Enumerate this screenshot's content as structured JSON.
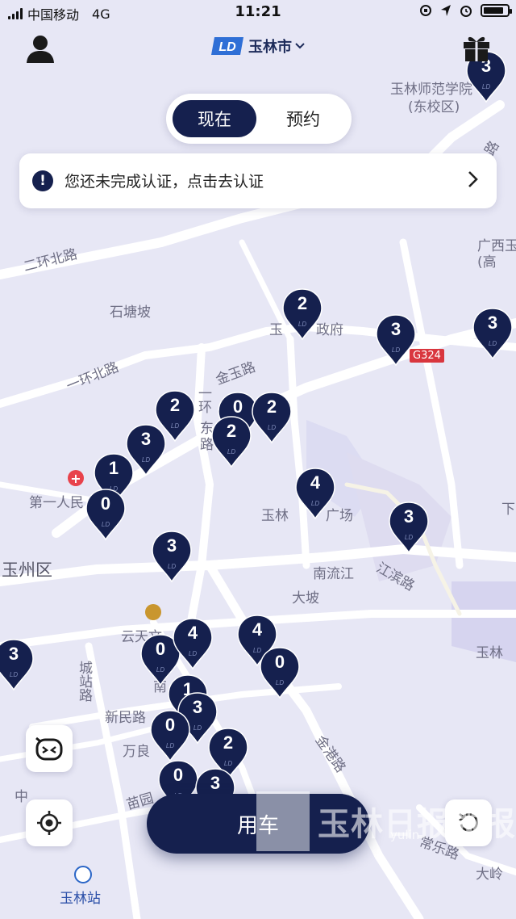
{
  "status_bar": {
    "carrier": "中国移动",
    "network": "4G",
    "time": "11:21",
    "icons": [
      "rotation-lock-icon",
      "location-arrow-icon",
      "alarm-icon",
      "battery-icon"
    ],
    "battery_level": 0.85
  },
  "header": {
    "brand_logo_text": "LD",
    "city": "玉林市",
    "city_dropdown_icon": "chevron-down-icon",
    "left_icon": "user-icon",
    "right_icon": "gift-icon"
  },
  "mode_toggle": {
    "options": [
      "现在",
      "预约"
    ],
    "selected": "现在"
  },
  "notice": {
    "text": "您还未完成认证，点击去认证",
    "icon": "exclamation-icon",
    "action_icon": "chevron-right-icon"
  },
  "map_labels": {
    "campus": "玉林师范学院",
    "campus_sub": "(东校区)",
    "gx_a": "广西玉",
    "gx_b": "(高",
    "ring2_north": "二环北路",
    "shitangpo": "石塘坡",
    "gov_a": "玉",
    "gov_b": "政府",
    "g324": "G324",
    "ring1_north": "一环北路",
    "jinyu": "金玉路",
    "ring1_east_a": "一环",
    "ring1_east_b": "东",
    "ring1_east_c": "路",
    "first_hosp": "第一人民",
    "square_a": "玉林",
    "square_b": "广场",
    "yuzhou": "玉州区",
    "nanliu": "南流江",
    "jiangbin": "江滨路",
    "dapo": "大坡",
    "yuntian": "云天文",
    "yulin_right": "玉林",
    "xia": "下",
    "chengzhan": "城站路",
    "nan": "南",
    "xinmin": "新民路",
    "wanliang": "万良",
    "jingang": "金港路",
    "miaoyuan": "苗园",
    "zhong": "中",
    "changle": "常乐路",
    "daling": "大岭",
    "station": "玉林站",
    "yu_top": "路"
  },
  "pins": [
    3,
    2,
    3,
    3,
    2,
    0,
    2,
    2,
    3,
    1,
    0,
    4,
    3,
    3,
    3,
    0,
    4,
    4,
    0,
    1,
    3,
    0,
    2,
    0,
    3
  ],
  "buttons": {
    "use_car": "用车",
    "chat_icon": "robot-chat-icon",
    "locate_icon": "locate-icon",
    "refresh_icon": "refresh-icon"
  },
  "watermark": {
    "text": "玉林日报微报",
    "sub": "yulin"
  },
  "colors": {
    "primary": "#15204e",
    "map_bg": "#e9e9f6",
    "road": "#ffffff",
    "hospital": "#e8424b",
    "g324": "#d9363e"
  }
}
